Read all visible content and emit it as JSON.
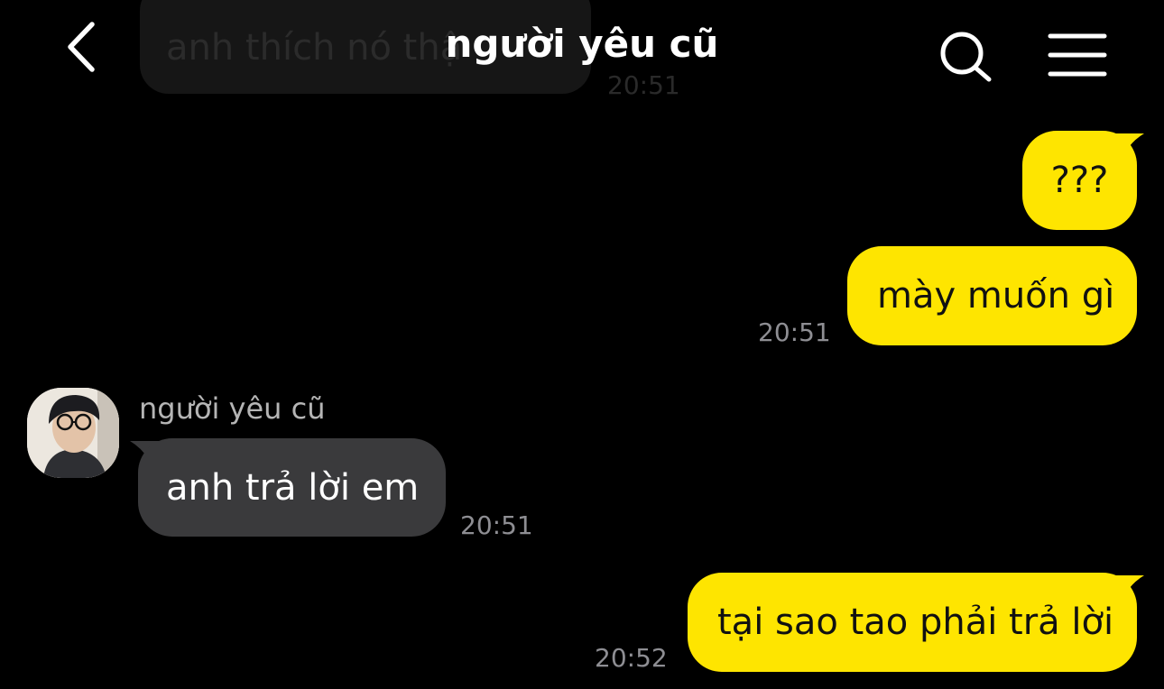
{
  "header": {
    "title": "người yêu cũ",
    "back_icon": "chevron-left-icon",
    "search_icon": "search-icon",
    "menu_icon": "hamburger-menu-icon"
  },
  "colors": {
    "background": "#000000",
    "my_bubble": "#FEE500",
    "their_bubble": "#3a3a3c",
    "timestamp": "#8e8e93"
  },
  "ghost_message": {
    "text": "anh thích nó thật",
    "time": "20:51"
  },
  "messages": [
    {
      "from": "me",
      "text": "???"
    },
    {
      "from": "me",
      "text": "mày muốn gì",
      "time": "20:51"
    },
    {
      "from": "them",
      "sender": "người yêu cũ",
      "text": "anh trả lời em",
      "time": "20:51"
    },
    {
      "from": "me",
      "text": "tại sao tao phải trả lời",
      "time": "20:52"
    }
  ]
}
